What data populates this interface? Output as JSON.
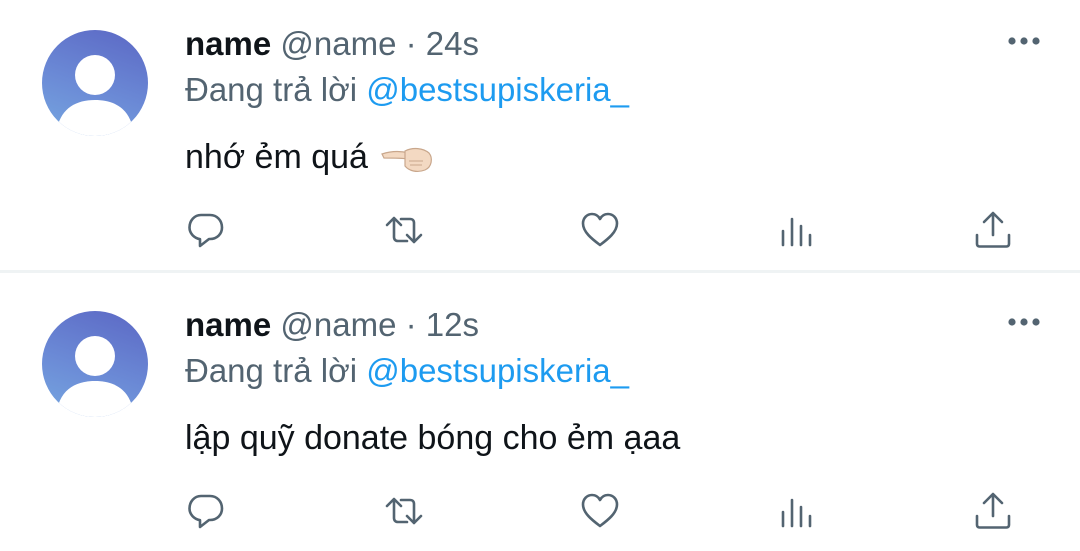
{
  "tweets": [
    {
      "display_name": "name",
      "handle": "@name",
      "separator": "·",
      "time": "24s",
      "reply_prefix": "Đang trả lời",
      "reply_to": "@bestsupiskeria_",
      "text": "nhớ ẻm quá",
      "emoji": "pointing-left-hand-icon"
    },
    {
      "display_name": "name",
      "handle": "@name",
      "separator": "·",
      "time": "12s",
      "reply_prefix": "Đang trả lời",
      "reply_to": "@bestsupiskeria_",
      "text": "lập quỹ donate bóng cho ẻm ạaa"
    }
  ],
  "icons": {
    "more": "more-options-icon",
    "reply": "reply-icon",
    "retweet": "retweet-icon",
    "like": "like-icon",
    "analytics": "analytics-icon",
    "share": "share-icon"
  },
  "colors": {
    "text": "#0f1419",
    "secondary": "#536471",
    "mention": "#1d9bf0",
    "divider": "#eff3f4",
    "avatar": "#6b8ad6"
  }
}
